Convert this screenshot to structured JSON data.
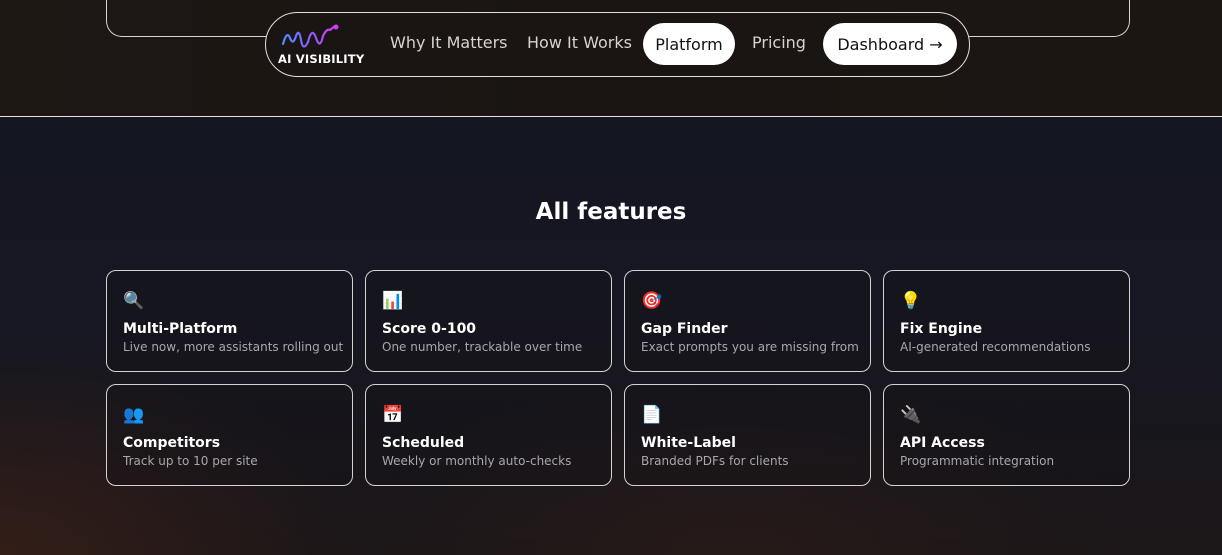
{
  "navbar": {
    "logo_text": "AI VISIBILITY",
    "links": [
      "Why It Matters",
      "How It Works",
      "Platform",
      "Pricing"
    ],
    "active": "Platform",
    "cta_label": "Dashboard →"
  },
  "features": {
    "title": "All features",
    "cards": [
      {
        "icon": "🔍",
        "icon_name": "magnifier-icon",
        "title": "Multi-Platform",
        "desc": "Live now, more assistants rolling out"
      },
      {
        "icon": "📊",
        "icon_name": "bar-chart-icon",
        "title": "Score 0-100",
        "desc": "One number, trackable over time"
      },
      {
        "icon": "🎯",
        "icon_name": "target-icon",
        "title": "Gap Finder",
        "desc": "Exact prompts you are missing from"
      },
      {
        "icon": "💡",
        "icon_name": "lightbulb-icon",
        "title": "Fix Engine",
        "desc": "AI-generated recommendations"
      },
      {
        "icon": "👥",
        "icon_name": "people-icon",
        "title": "Competitors",
        "desc": "Track up to 10 per site"
      },
      {
        "icon": "📅",
        "icon_name": "calendar-icon",
        "title": "Scheduled",
        "desc": "Weekly or monthly auto-checks"
      },
      {
        "icon": "📄",
        "icon_name": "document-icon",
        "title": "White-Label",
        "desc": "Branded PDFs for clients"
      },
      {
        "icon": "🔌",
        "icon_name": "plug-icon",
        "title": "API Access",
        "desc": "Programmatic integration"
      }
    ]
  },
  "colors": {
    "accent_logo_pink": "#c33cff",
    "accent_logo_blue": "#4a8cff",
    "pill_bg": "#ffffff"
  }
}
